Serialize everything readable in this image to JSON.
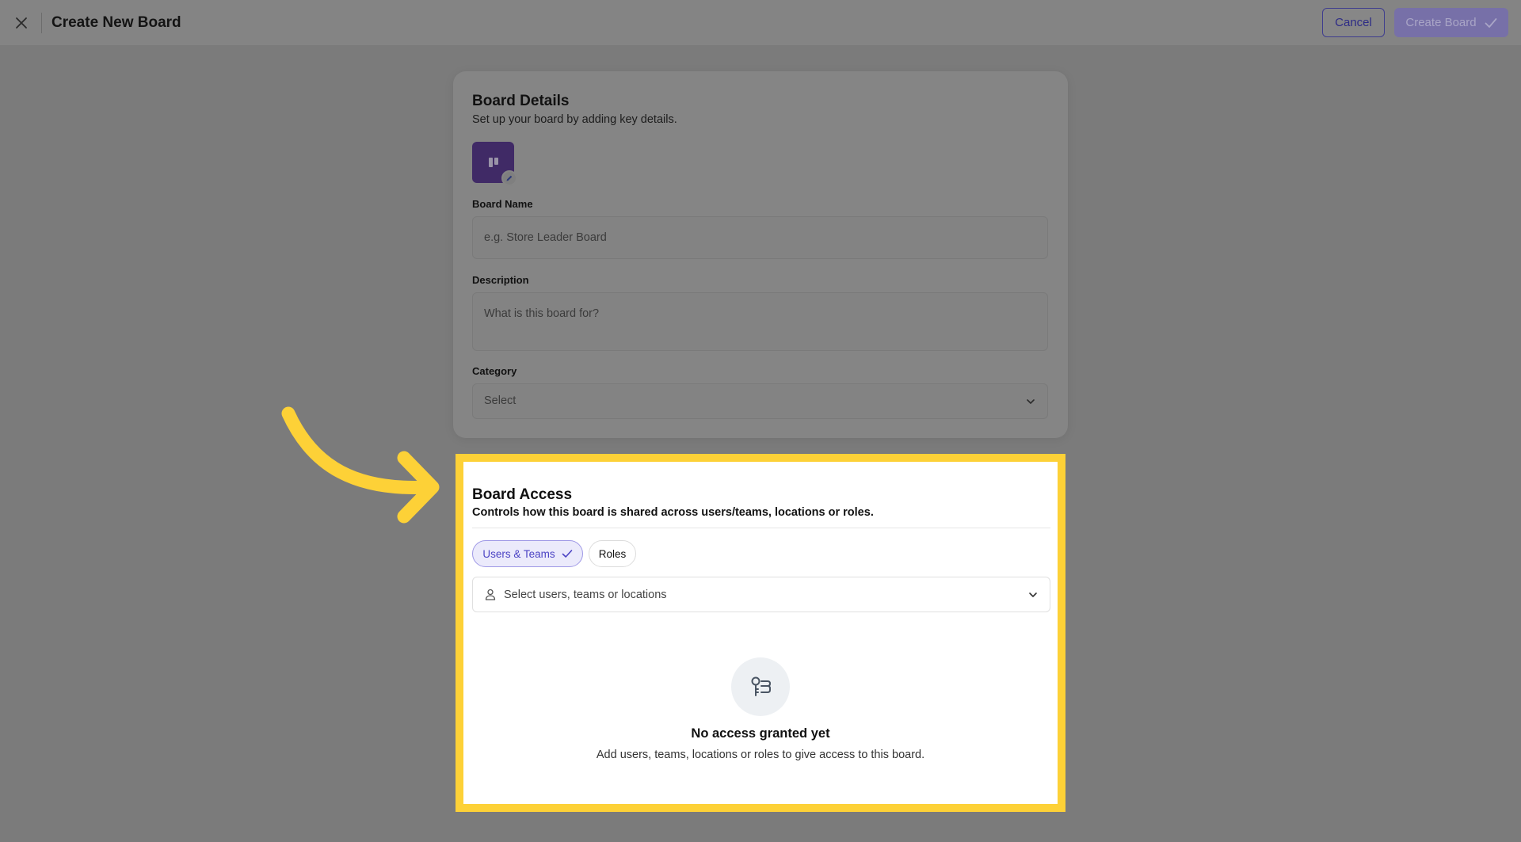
{
  "header": {
    "title": "Create New Board",
    "close_icon": "close-icon",
    "cancel_label": "Cancel",
    "create_label": "Create Board"
  },
  "details": {
    "title": "Board Details",
    "subtitle": "Set up your board by adding key details.",
    "board_name_label": "Board Name",
    "board_name_placeholder": "e.g. Store Leader Board",
    "description_label": "Description",
    "description_placeholder": "What is this board for?",
    "category_label": "Category",
    "category_value": "Select"
  },
  "access": {
    "title": "Board Access",
    "subtitle": "Controls how this board is shared across users/teams, locations or roles.",
    "tabs": [
      {
        "label": "Users & Teams",
        "selected": true
      },
      {
        "label": "Roles",
        "selected": false
      }
    ],
    "select_placeholder": "Select users, teams or locations",
    "empty_title": "No access granted yet",
    "empty_subtitle": "Add users, teams, locations or roles to give access to this board."
  },
  "colors": {
    "highlight": "#fdd137",
    "accent": "#4c44c4",
    "board_icon_bg": "#402a66"
  }
}
